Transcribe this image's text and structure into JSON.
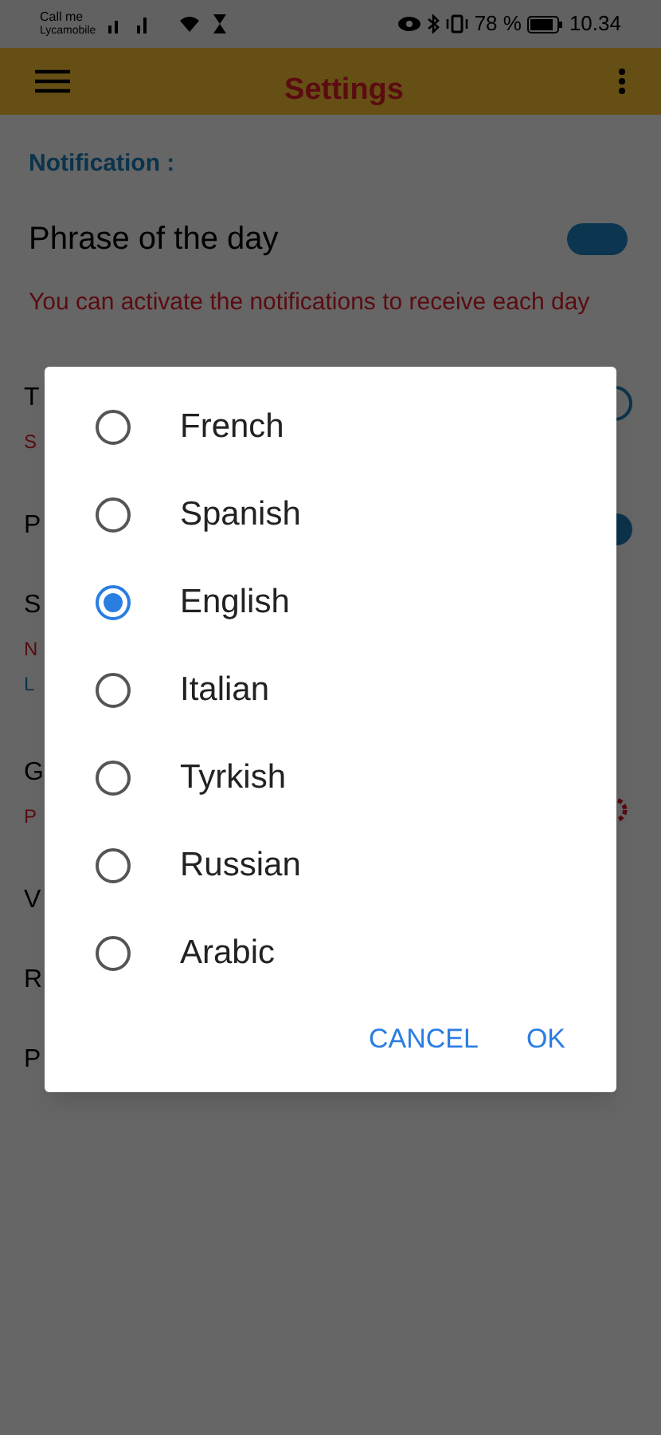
{
  "status_bar": {
    "carrier": "Call me",
    "network": "Lycamobile",
    "battery": "78 %",
    "time": "10.34"
  },
  "header": {
    "title": "Settings"
  },
  "section": {
    "title": "Notification :"
  },
  "setting": {
    "title": "Phrase of the day",
    "description": "You can activate the notifications to receive each day",
    "on": true
  },
  "obscured_rows": [
    {
      "title": "T",
      "description": "S",
      "control": {
        "kind": "radio"
      }
    },
    {
      "title": "P",
      "control": {
        "kind": "toggle",
        "on": true
      }
    },
    {
      "title": "S",
      "description": "N",
      "link": "L"
    },
    {
      "title": "G",
      "description": "P",
      "control": {
        "kind": "icon"
      }
    },
    {
      "title": "V"
    },
    {
      "title": "R"
    },
    {
      "title": "P"
    }
  ],
  "dialog": {
    "options": [
      {
        "label": "French",
        "selected": false
      },
      {
        "label": "Spanish",
        "selected": false
      },
      {
        "label": "English",
        "selected": true
      },
      {
        "label": "Italian",
        "selected": false
      },
      {
        "label": "Tyrkish",
        "selected": false
      },
      {
        "label": "Russian",
        "selected": false
      },
      {
        "label": "Arabic",
        "selected": false
      }
    ],
    "buttons": [
      "CANCEL",
      "OK"
    ]
  }
}
